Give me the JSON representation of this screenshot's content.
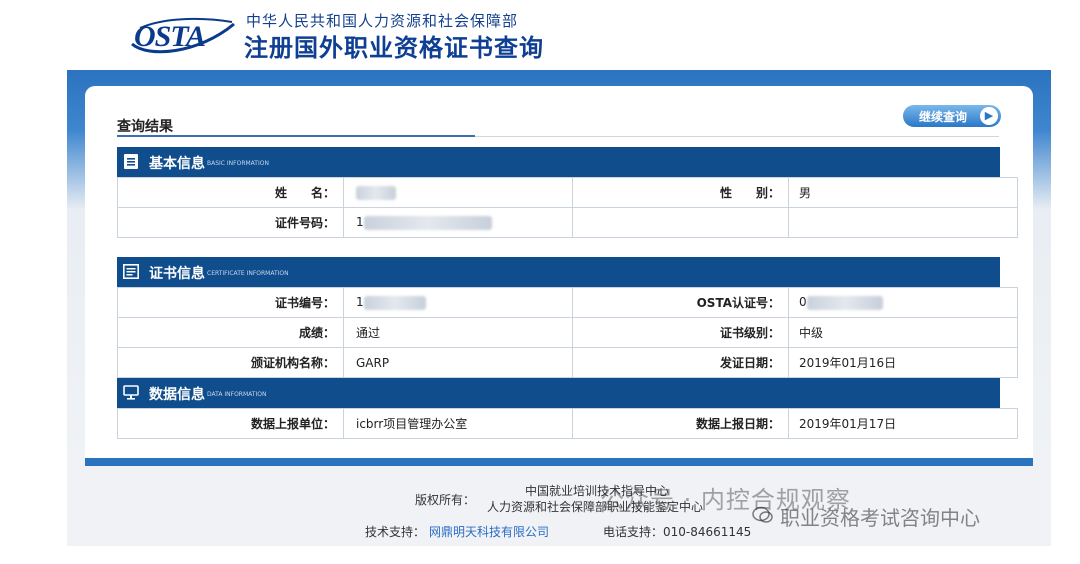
{
  "header": {
    "logo_text": "OSTA",
    "org_name": "中华人民共和国人力资源和社会保障部",
    "site_title": "注册国外职业资格证书查询"
  },
  "result": {
    "title": "查询结果",
    "continue_label": "继续查询"
  },
  "basic": {
    "title": "基本信息",
    "subtitle": "BASIC INFORMATION",
    "icon": "document-icon",
    "name_label": "姓　　名：",
    "name_value": "",
    "gender_label": "性　　别：",
    "gender_value": "男",
    "id_label": "证件号码：",
    "id_value": "1"
  },
  "certificate": {
    "title": "证书信息",
    "subtitle": "CERTIFICATE INFORMATION",
    "icon": "certificate-icon",
    "cert_no_label": "证书编号：",
    "cert_no_value": "1",
    "osta_no_label": "OSTA认证号：",
    "osta_no_value": "0",
    "result_label": "成绩：",
    "result_value": "通过",
    "level_label": "证书级别：",
    "level_value": "中级",
    "issuer_label": "颁证机构名称：",
    "issuer_value": "GARP",
    "issue_date_label": "发证日期：",
    "issue_date_value": "2019年01月16日"
  },
  "data_info": {
    "title": "数据信息",
    "subtitle": "DATA INFORMATION",
    "icon": "monitor-icon",
    "unit_label": "数据上报单位：",
    "unit_value": "icbrr项目管理办公室",
    "report_date_label": "数据上报日期：",
    "report_date_value": "2019年01月17日"
  },
  "footer": {
    "copyright_label": "版权所有：",
    "org_line1": "中国就业培训技术指导中心",
    "org_line2": "人力资源和社会保障部职业技能鉴定中心",
    "tech_label": "技术支持：",
    "tech_link": "网鼎明天科技有限公司",
    "phone": "电话支持：010-84661145"
  },
  "watermark": {
    "line1": "公众号 · 内控合规观察",
    "line2": "职业资格考试咨询中心"
  },
  "colors": {
    "section_header": "#0f4d8d",
    "frame_blue": "#2b73bf",
    "link": "#2a6cc7"
  }
}
